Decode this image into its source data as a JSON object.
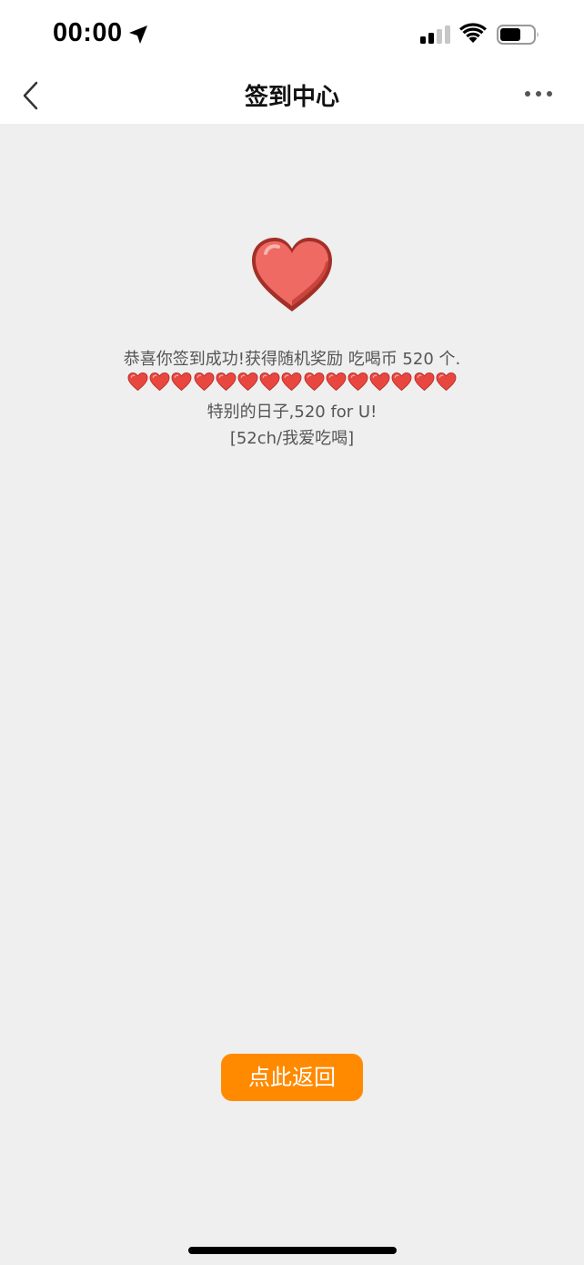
{
  "status_bar": {
    "time": "00:00",
    "icons": [
      "location-arrow-icon",
      "cellular-signal-icon",
      "wifi-icon",
      "battery-icon"
    ]
  },
  "nav": {
    "title": "签到中心",
    "back_icon": "chevron-left-icon",
    "more_icon": "more-dots-icon"
  },
  "content": {
    "heart_icon": "heart-icon",
    "message_line1": "恭喜你签到成功!获得随机奖励 吃喝币 520 个.",
    "hearts_count": 15,
    "message_line3": "特别的日子,520 for U!",
    "message_line4": "[52ch/我爱吃喝]"
  },
  "button": {
    "label": "点此返回"
  },
  "colors": {
    "background": "#efefef",
    "button": "#ff8a00",
    "heart": "#e8473f"
  }
}
